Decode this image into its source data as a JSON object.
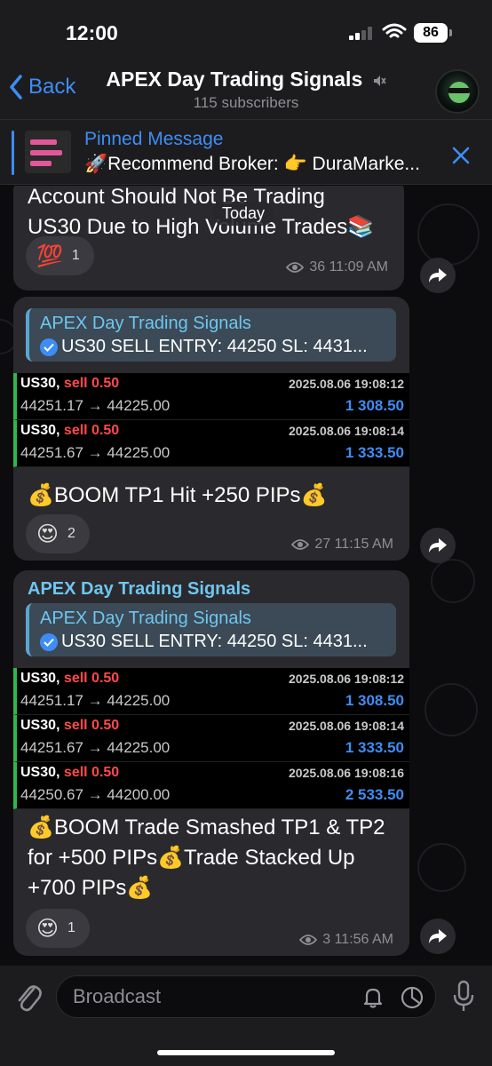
{
  "status": {
    "time": "12:00",
    "battery": "86"
  },
  "nav": {
    "back_label": "Back",
    "title": "APEX Day Trading Signals",
    "subtitle": "115 subscribers"
  },
  "pinned": {
    "title": "Pinned Message",
    "text": "🚀Recommend Broker: 👉 DuraMarke..."
  },
  "date_chip": "Today",
  "messages": [
    {
      "text_lines": [
        "Account Should Not Be Trading",
        "US30 Due to High Volume Trades📚"
      ],
      "reaction": {
        "emoji": "💯",
        "count": "1"
      },
      "views": "36",
      "time": "11:09 AM"
    },
    {
      "quote": {
        "title": "APEX Day Trading Signals",
        "text": "US30 SELL ENTRY: 44250 SL: 4431..."
      },
      "trades": [
        {
          "symbol": "US30,",
          "side": "sell 0.50",
          "date": "2025.08.06 19:08:12",
          "prices": "44251.17 → 44225.00",
          "profit": "1 308.50"
        },
        {
          "symbol": "US30,",
          "side": "sell 0.50",
          "date": "2025.08.06 19:08:14",
          "prices": "44251.67 → 44225.00",
          "profit": "1 333.50"
        }
      ],
      "text": "💰BOOM TP1 Hit +250 PIPs💰",
      "reaction": {
        "emoji": "😍",
        "count": "2"
      },
      "views": "27",
      "time": "11:15 AM"
    },
    {
      "sender": "APEX Day Trading Signals",
      "quote": {
        "title": "APEX Day Trading Signals",
        "text": "US30 SELL ENTRY: 44250 SL: 4431..."
      },
      "trades": [
        {
          "symbol": "US30,",
          "side": "sell 0.50",
          "date": "2025.08.06 19:08:12",
          "prices": "44251.17 → 44225.00",
          "profit": "1 308.50"
        },
        {
          "symbol": "US30,",
          "side": "sell 0.50",
          "date": "2025.08.06 19:08:14",
          "prices": "44251.67 → 44225.00",
          "profit": "1 333.50"
        },
        {
          "symbol": "US30,",
          "side": "sell 0.50",
          "date": "2025.08.06 19:08:16",
          "prices": "44250.67 → 44200.00",
          "profit": "2 533.50"
        }
      ],
      "text_lines": [
        "💰BOOM Trade Smashed TP1 & TP2",
        "for +500 PIPs💰Trade Stacked Up",
        "+700 PIPs💰"
      ],
      "reaction": {
        "emoji": "😍",
        "count": "1"
      },
      "views": "3",
      "time": "11:56 AM"
    }
  ],
  "input": {
    "placeholder": "Broadcast"
  },
  "icons": {
    "back": "chevron-left-icon",
    "mute": "muted-speaker-icon",
    "close": "close-icon",
    "views": "eye-icon",
    "share": "share-arrow-icon",
    "attach": "paperclip-icon",
    "bell": "bell-icon",
    "timer": "timer-icon",
    "mic": "microphone-icon"
  },
  "colors": {
    "accent": "#3e8df6",
    "bubble": "#2a2a2e",
    "sell": "#ff4a4a",
    "profit": "#3e8df6",
    "trade_bar": "#2eb84b"
  }
}
